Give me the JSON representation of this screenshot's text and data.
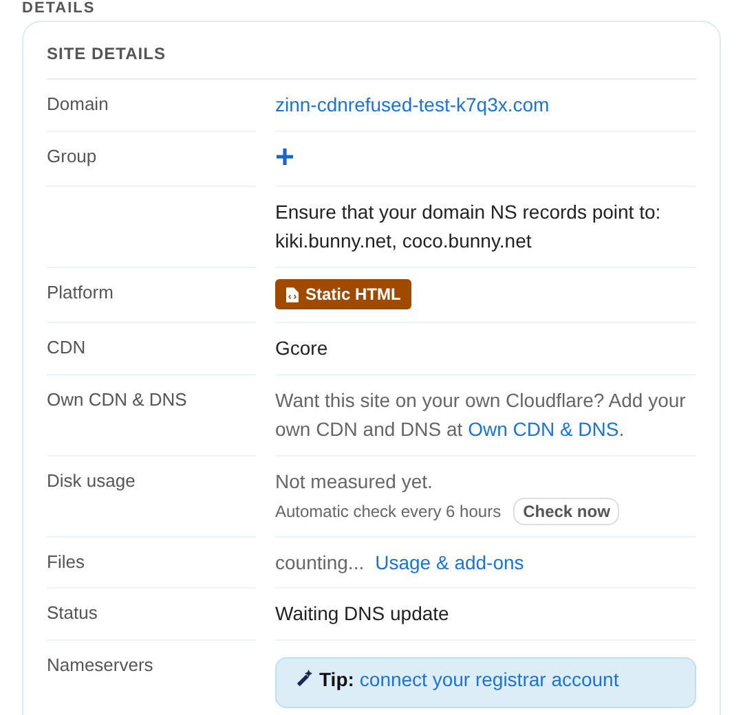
{
  "section_title": "DETAILS",
  "card": {
    "title": "SITE DETAILS",
    "rows": [
      {
        "kind": "link",
        "label": "Domain",
        "value": "zinn-cdnrefused-test-k7q3x.com"
      },
      {
        "kind": "add",
        "label": "Group"
      },
      {
        "kind": "note",
        "value": "Ensure that your domain NS records point to: kiki.bunny.net, coco.bunny.net"
      },
      {
        "kind": "badge",
        "label": "Platform",
        "value": "Static HTML"
      },
      {
        "kind": "text",
        "label": "CDN",
        "value": "Gcore"
      },
      {
        "kind": "muted_link",
        "label": "Own CDN & DNS",
        "value": "Want this site on your own Cloudflare? Add your own CDN and DNS at",
        "link": "Own CDN & DNS",
        "after": "."
      },
      {
        "kind": "disk",
        "label": "Disk usage",
        "value": "Not measured yet.",
        "hint": "Automatic check every 6 hours",
        "button": "Check now"
      },
      {
        "kind": "files",
        "label": "Files",
        "value": "counting...",
        "link": "Usage & add-ons"
      },
      {
        "kind": "text",
        "label": "Status",
        "value": "Waiting DNS update"
      },
      {
        "kind": "tip",
        "label": "Nameservers",
        "tip_label": "Tip:",
        "link": "connect your registrar account"
      }
    ]
  }
}
